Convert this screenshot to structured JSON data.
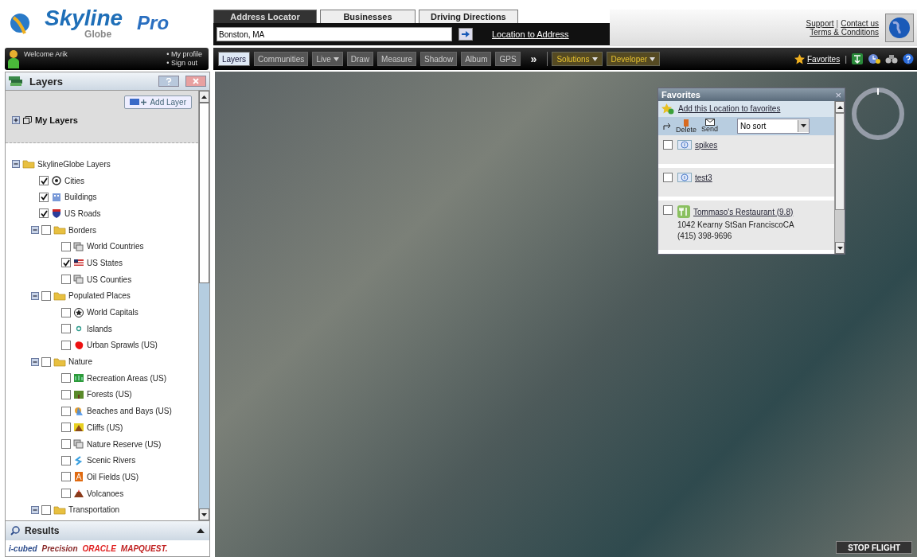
{
  "logo": {
    "brand": "Skyline",
    "sub": "Globe",
    "edition": "Pro"
  },
  "user": {
    "welcome": "Welcome Arik",
    "links": [
      "• My profile",
      "• Sign out"
    ]
  },
  "address": {
    "tabs": [
      {
        "label": "Address Locator",
        "selected": true
      },
      {
        "label": "Businesses",
        "selected": false
      },
      {
        "label": "Driving Directions",
        "selected": false
      }
    ],
    "value": "Bonston, MA",
    "link": "Location to Address"
  },
  "support": {
    "links": [
      "Support",
      "Contact us",
      "Terms & Conditions"
    ],
    "separator": "|"
  },
  "toolbar": {
    "buttons": [
      {
        "label": "Layers",
        "selected": true,
        "dropdown": false
      },
      {
        "label": "Communities",
        "selected": false,
        "dropdown": false
      },
      {
        "label": "Live",
        "selected": false,
        "dropdown": true
      },
      {
        "label": "Draw",
        "selected": false,
        "dropdown": false
      },
      {
        "label": "Measure",
        "selected": false,
        "dropdown": false
      },
      {
        "label": "Shadow",
        "selected": false,
        "dropdown": false
      },
      {
        "label": "Album",
        "selected": false,
        "dropdown": false
      },
      {
        "label": "GPS",
        "selected": false,
        "dropdown": false
      }
    ],
    "more": "»",
    "menus": [
      {
        "label": "Solutions"
      },
      {
        "label": "Developer"
      }
    ],
    "favorites": "Favorites",
    "separator": "|"
  },
  "layers": {
    "title": "Layers",
    "add_layer": "Add Layer",
    "my_layers": "My Layers",
    "tree": {
      "label": "SkylineGlobe Layers",
      "expanded": true,
      "children": [
        {
          "label": "Cities",
          "checked": true
        },
        {
          "label": "Buildings",
          "checked": true
        },
        {
          "label": "US Roads",
          "checked": true
        },
        {
          "label": "Borders",
          "checked": false,
          "expanded": true,
          "children": [
            {
              "label": "World Countries",
              "checked": false
            },
            {
              "label": "US States",
              "checked": true
            },
            {
              "label": "US Counties",
              "checked": false
            }
          ]
        },
        {
          "label": "Populated Places",
          "checked": false,
          "expanded": true,
          "children": [
            {
              "label": "World Capitals",
              "checked": false
            },
            {
              "label": "Islands",
              "checked": false
            },
            {
              "label": "Urban Sprawls (US)",
              "checked": false
            }
          ]
        },
        {
          "label": "Nature",
          "checked": false,
          "expanded": true,
          "children": [
            {
              "label": "Recreation Areas (US)",
              "checked": false
            },
            {
              "label": "Forests (US)",
              "checked": false
            },
            {
              "label": "Beaches and Bays (US)",
              "checked": false
            },
            {
              "label": "Cliffs (US)",
              "checked": false
            },
            {
              "label": "Nature Reserve (US)",
              "checked": false
            },
            {
              "label": "Scenic Rivers",
              "checked": false
            },
            {
              "label": "Oil Fields (US)",
              "checked": false
            },
            {
              "label": "Volcanoes",
              "checked": false
            }
          ]
        },
        {
          "label": "Transportation",
          "checked": false,
          "expanded": true
        }
      ]
    }
  },
  "results": {
    "title": "Results"
  },
  "partners": [
    "i-cubed",
    "Precision",
    "ORACLE",
    "MAPQUEST."
  ],
  "favorites_panel": {
    "title": "Favorites",
    "close": "×",
    "add": "Add this Location to favorites",
    "actions": [
      "Delete",
      "Send"
    ],
    "sort": "No sort",
    "items": [
      {
        "kind": "info",
        "name": "spikes",
        "checked": false
      },
      {
        "kind": "info",
        "name": "test3",
        "checked": false
      },
      {
        "kind": "restaurant",
        "name": "Tommaso's Restaurant (9.8)",
        "checked": false,
        "address": "1042 Kearny StSan FranciscoCA",
        "phone": "(415) 398-9696"
      }
    ]
  },
  "stop_flight": "STOP FLIGHT"
}
